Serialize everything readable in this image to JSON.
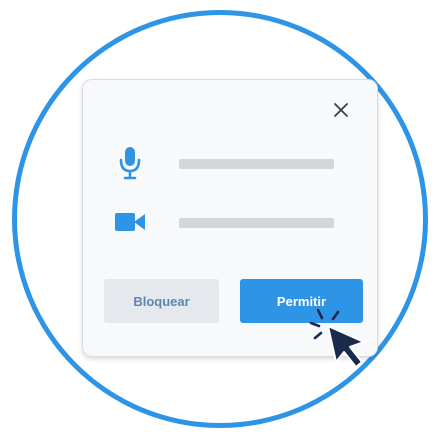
{
  "dialog": {
    "close_label": "×",
    "permissions": [
      {
        "icon": "microphone-icon"
      },
      {
        "icon": "video-camera-icon"
      }
    ],
    "block_label": "Bloquear",
    "allow_label": "Permitir"
  },
  "colors": {
    "accent": "#2e95e6",
    "block_text": "#5b86b3",
    "block_bg": "#e5e8ec",
    "placeholder_bar": "#d3d6da",
    "dialog_bg": "#f8f9fb",
    "cursor": "#1a2a4d"
  }
}
